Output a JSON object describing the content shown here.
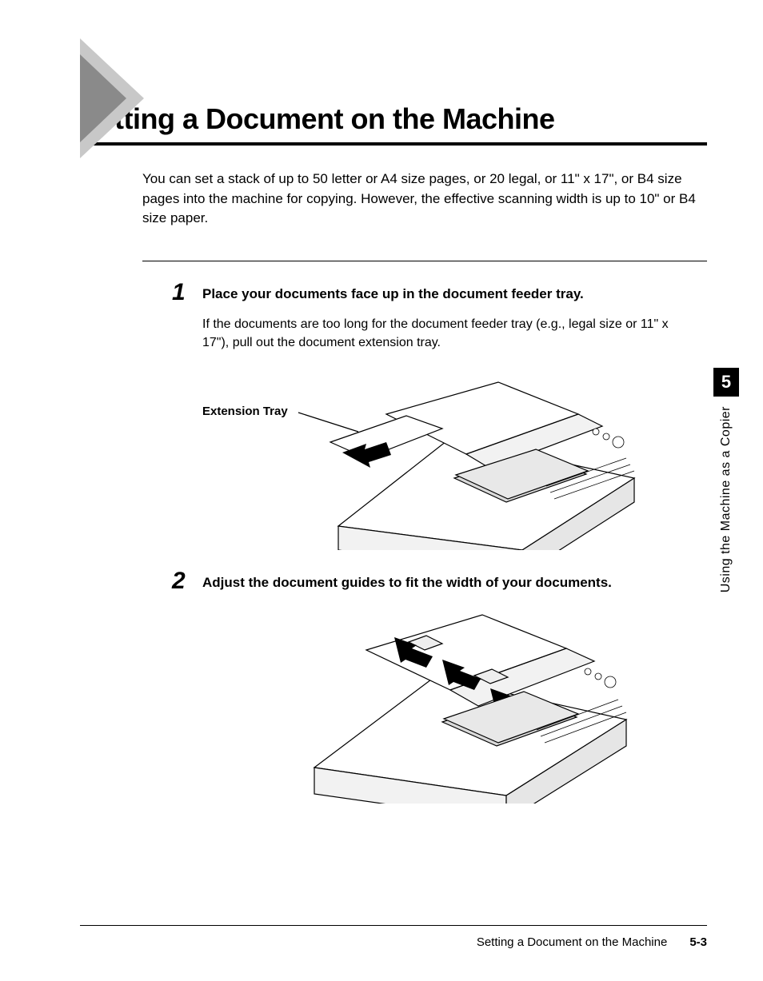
{
  "title": "Setting a Document on the Machine",
  "intro": "You can set a stack of up to 50 letter or A4 size pages, or 20 legal, or 11\" x 17\", or B4 size pages into the machine for copying. However, the effective scanning width is up to 10\" or B4 size paper.",
  "steps": [
    {
      "number": "1",
      "heading": "Place your documents face up in the document feeder tray.",
      "body": "If the documents are too long for the document feeder tray (e.g., legal size or 11\" x 17\"), pull out the document extension tray.",
      "callout": "Extension Tray"
    },
    {
      "number": "2",
      "heading": "Adjust the document guides to fit the width of your documents.",
      "body": ""
    }
  ],
  "sidebar": {
    "chapter_number": "5",
    "chapter_label": "Using the Machine as a Copier"
  },
  "footer": {
    "title": "Setting a Document on the Machine",
    "page": "5-3"
  }
}
